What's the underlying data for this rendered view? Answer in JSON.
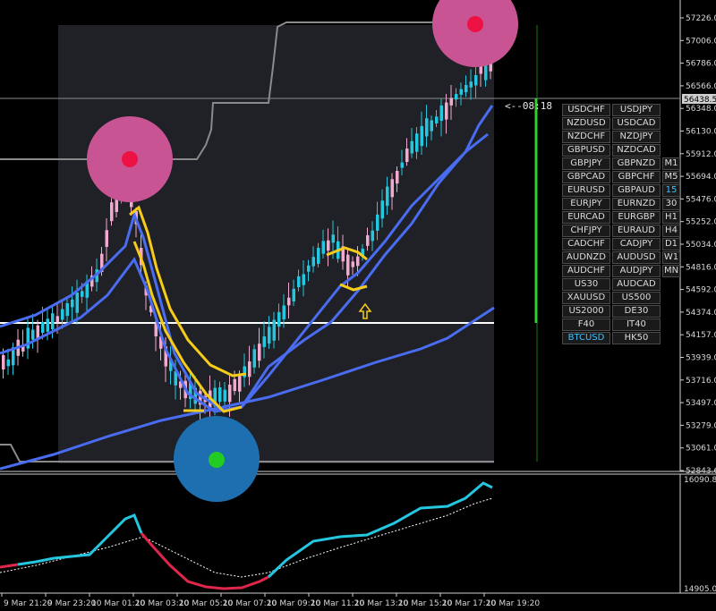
{
  "colors": {
    "background": "#000000",
    "shaded_region": "#1f2126",
    "bull_candle": "#25c6e0",
    "bear_candle": "#f2a9cf",
    "ma_blue": "#4a6cf0",
    "band_yellow": "#f5cc1a",
    "channel_gray": "#8a8a8a",
    "level_line": "#ffffff",
    "vertical_green": "#2fd12f",
    "signal_pink": "#c85494",
    "signal_blue": "#1e6fb0",
    "dot_red": "#ee1144",
    "dot_green": "#22cc22",
    "osc_cyan": "#25c6e0",
    "osc_red": "#e0264a",
    "arrow_color": "#f5cc1a"
  },
  "price_axis": {
    "labels": [
      "57226.00",
      "57006.00",
      "56786.00",
      "56566.00",
      "56348.00",
      "56130.00",
      "55912.00",
      "55694.00",
      "55476.00",
      "55252.00",
      "55034.00",
      "54816.00",
      "54592.00",
      "54374.00",
      "54157.00",
      "53939.00",
      "53716.00",
      "53497.00",
      "53279.00",
      "53061.00",
      "52843.60"
    ],
    "current_price": "56438.52"
  },
  "oscillator_axis": {
    "top_label": "16090.80",
    "bottom_label": "14905.00"
  },
  "time_axis": {
    "labels": [
      "9 Mar 21:20",
      "9 Mar 23:20",
      "10 Mar 01:20",
      "10 Mar 03:20",
      "10 Mar 05:20",
      "10 Mar 07:20",
      "10 Mar 09:20",
      "10 Mar 11:20",
      "10 Mar 13:20",
      "10 Mar 15:20",
      "10 Mar 17:20",
      "10 Mar 19:20"
    ]
  },
  "countdown": "<--08:18",
  "symbol_panel": {
    "rows": [
      {
        "left": "USDCHF",
        "right": "USDJPY",
        "tf": ""
      },
      {
        "left": "NZDUSD",
        "right": "USDCAD",
        "tf": ""
      },
      {
        "left": "NZDCHF",
        "right": "NZDJPY",
        "tf": ""
      },
      {
        "left": "GBPUSD",
        "right": "NZDCAD",
        "tf": ""
      },
      {
        "left": "GBPJPY",
        "right": "GBPNZD",
        "tf": "M1"
      },
      {
        "left": "GBPCAD",
        "right": "GBPCHF",
        "tf": "M5"
      },
      {
        "left": "EURUSD",
        "right": "GBPAUD",
        "tf": "15"
      },
      {
        "left": "EURJPY",
        "right": "EURNZD",
        "tf": "30"
      },
      {
        "left": "EURCAD",
        "right": "EURGBP",
        "tf": "H1"
      },
      {
        "left": "CHFJPY",
        "right": "EURAUD",
        "tf": "H4"
      },
      {
        "left": "CADCHF",
        "right": "CADJPY",
        "tf": "D1"
      },
      {
        "left": "AUDNZD",
        "right": "AUDUSD",
        "tf": "W1"
      },
      {
        "left": "AUDCHF",
        "right": "AUDJPY",
        "tf": "MN"
      },
      {
        "left": "US30",
        "right": "AUDCAD",
        "tf": ""
      },
      {
        "left": "XAUUSD",
        "right": "US500",
        "tf": ""
      },
      {
        "left": "US2000",
        "right": "DE30",
        "tf": ""
      },
      {
        "left": "F40",
        "right": "IT40",
        "tf": ""
      },
      {
        "left": "BTCUSD",
        "right": "HK50",
        "tf": ""
      }
    ],
    "active_symbol": "BTCUSD",
    "active_timeframe": "15"
  }
}
